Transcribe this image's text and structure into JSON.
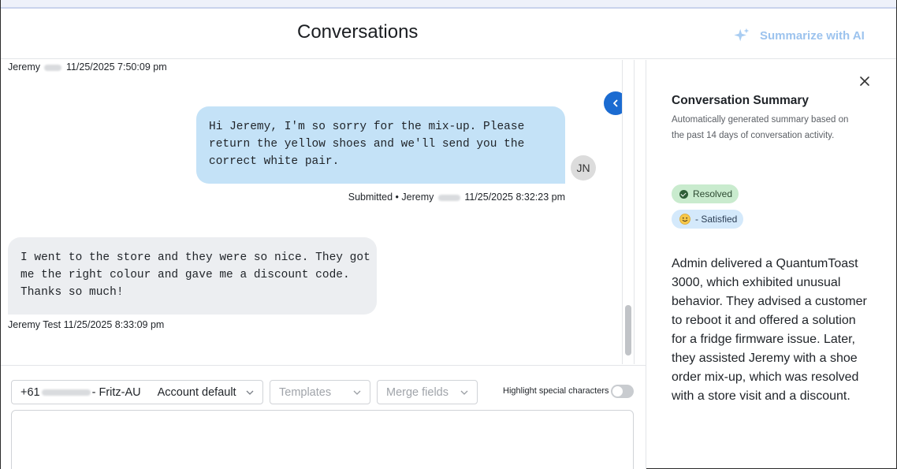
{
  "header": {
    "title": "Conversations",
    "summarize_label": "Summarize with AI"
  },
  "messages": [
    {
      "direction": "inbound",
      "sender_first": "Jeremy",
      "sender_last": "",
      "timestamp": "11/25/2025 7:50:09 pm"
    },
    {
      "direction": "outbound",
      "text": "Hi Jeremy, I'm so sorry for the mix-up. Please\nreturn the yellow shoes and we'll send you the\ncorrect white pair.",
      "status": "Submitted",
      "separator": "•",
      "sender_first": "Jeremy",
      "sender_last": "",
      "timestamp": "11/25/2025 8:32:23 pm",
      "avatar_initials": "JN"
    },
    {
      "direction": "inbound",
      "text": "I went to the store and they were so nice. They got\nme the right colour and gave me a discount code.\nThanks so much!",
      "sender_first": "Jeremy",
      "sender_last": "Test",
      "timestamp": "11/25/2025 8:33:09 pm"
    }
  ],
  "compose": {
    "sender_prefix": "+61",
    "sender_suffix": "- Fritz-AU",
    "account": "Account default",
    "templates_placeholder": "Templates",
    "merge_placeholder": "Merge fields",
    "highlight_label": "Highlight special characters",
    "highlight_on": false,
    "message_value": ""
  },
  "summary": {
    "title": "Conversation Summary",
    "subtitle": "Automatically generated summary based on the past 14 days of conversation activity.",
    "status_badge": "Resolved",
    "sentiment_badge": "- Satisfied",
    "text": "Admin delivered a QuantumToast 3000, which exhibited unusual behavior. They advised a customer to reboot it and offered a solution for a fridge firmware issue. Later, they assisted Jeremy with a shoe order mix-up, which was resolved with a store visit and a discount."
  },
  "icons": {
    "summarize": "sparkle-icon",
    "collapse": "chevron-left-icon",
    "close": "close-icon",
    "status": "check-circle-icon",
    "sentiment": "smiley-icon",
    "dropdown": "chevron-down-icon"
  },
  "colors": {
    "accent_blue": "#1b6bd1",
    "outbound_bubble": "#c4e2f7",
    "inbound_bubble": "#eceef1",
    "resolved_badge": "#c9ebce",
    "satisfied_badge": "#d4e9fb",
    "summarize_label": "#9cc3ee"
  }
}
